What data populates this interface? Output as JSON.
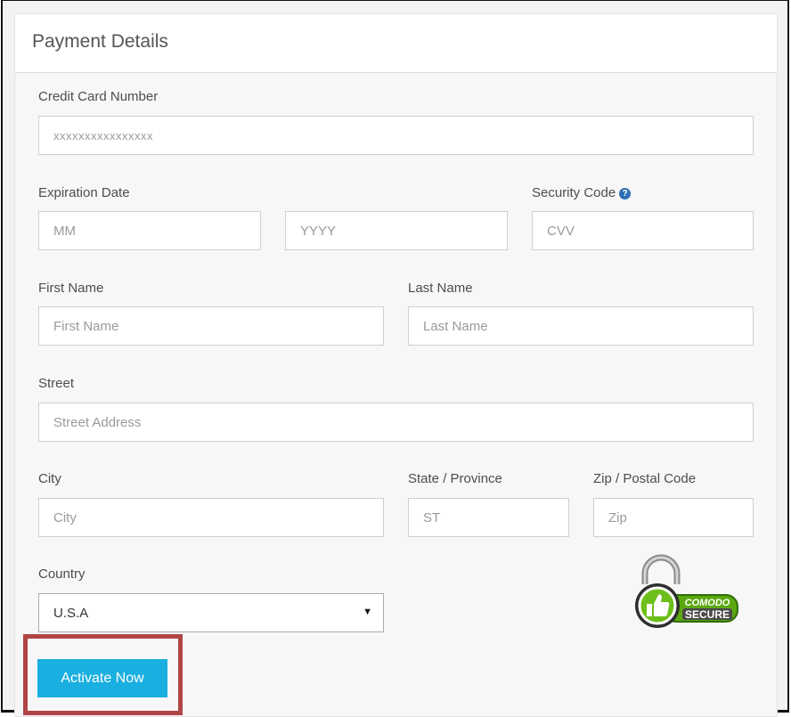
{
  "panel": {
    "title": "Payment Details"
  },
  "card": {
    "label": "Credit Card Number",
    "placeholder": "xxxxxxxxxxxxxxxx"
  },
  "expiration": {
    "label": "Expiration Date",
    "month_placeholder": "MM",
    "year_placeholder": "YYYY"
  },
  "security": {
    "label": "Security Code",
    "help_icon": "?",
    "placeholder": "CVV"
  },
  "first_name": {
    "label": "First Name",
    "placeholder": "First Name"
  },
  "last_name": {
    "label": "Last Name",
    "placeholder": "Last Name"
  },
  "street": {
    "label": "Street",
    "placeholder": "Street Address"
  },
  "city": {
    "label": "City",
    "placeholder": "City"
  },
  "state": {
    "label": "State / Province",
    "placeholder": "ST"
  },
  "zip": {
    "label": "Zip / Postal Code",
    "placeholder": "Zip"
  },
  "country": {
    "label": "Country",
    "selected": "U.S.A",
    "caret": "▼"
  },
  "badge": {
    "brand": "COMODO",
    "text": "SECURE",
    "icon": "thumbs-up-lock-icon"
  },
  "submit": {
    "label": "Activate Now"
  },
  "colors": {
    "button": "#19afe0",
    "highlight": "#b24545",
    "help_icon": "#2d6fb6",
    "badge_green": "#5aa80f"
  }
}
